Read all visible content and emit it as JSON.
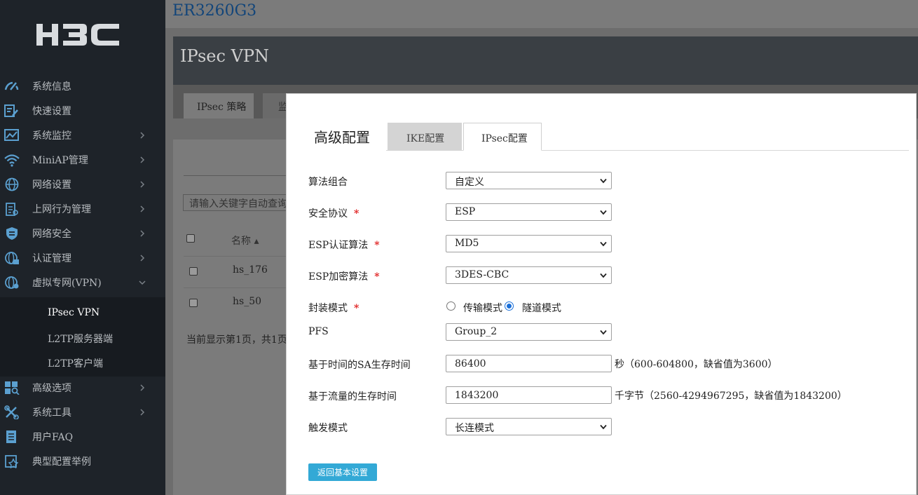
{
  "brand": {
    "logo_text": "H3C",
    "model": "ER3260G3"
  },
  "sidebar": {
    "items": [
      {
        "label": "系统信息",
        "icon": "speedometer-icon",
        "has_arrow": false
      },
      {
        "label": "快速设置",
        "icon": "edit-doc-icon",
        "has_arrow": false
      },
      {
        "label": "系统监控",
        "icon": "monitor-chart-icon",
        "has_arrow": true
      },
      {
        "label": "MiniAP管理",
        "icon": "wifi-icon",
        "has_arrow": true
      },
      {
        "label": "网络设置",
        "icon": "globe-icon",
        "has_arrow": true
      },
      {
        "label": "上网行为管理",
        "icon": "clipboard-icon",
        "has_arrow": true
      },
      {
        "label": "网络安全",
        "icon": "shield-icon",
        "has_arrow": true
      },
      {
        "label": "认证管理",
        "icon": "globe-lock-icon",
        "has_arrow": true
      },
      {
        "label": "虚拟专网(VPN)",
        "icon": "globe-vpn-icon",
        "has_arrow": true,
        "expanded": true
      },
      {
        "label": "高级选项",
        "icon": "grid-search-icon",
        "has_arrow": true
      },
      {
        "label": "系统工具",
        "icon": "tools-icon",
        "has_arrow": true
      },
      {
        "label": "用户FAQ",
        "icon": "document-icon",
        "has_arrow": false
      },
      {
        "label": "典型配置举例",
        "icon": "config-example-icon",
        "has_arrow": false
      }
    ],
    "vpn_subitems": [
      {
        "label": "IPsec VPN",
        "active": true
      },
      {
        "label": "L2TP服务器端",
        "active": false
      },
      {
        "label": "L2TP客户端",
        "active": false
      }
    ]
  },
  "page": {
    "title": "IPsec VPN",
    "tabs": [
      "IPsec 策略",
      "监"
    ],
    "search_placeholder": "请输入关键字自动查询",
    "table": {
      "header_name": "名称",
      "rows": [
        "hs_176",
        "hs_50"
      ]
    },
    "pagination_text": "当前显示第1页，共1页,"
  },
  "modal": {
    "title": "高级配置",
    "tabs": [
      {
        "label": "IKE配置",
        "active": false
      },
      {
        "label": "IPsec配置",
        "active": true
      }
    ],
    "fields": {
      "algorithm_suite": {
        "label": "算法组合",
        "value": "自定义"
      },
      "security_protocol": {
        "label": "安全协议",
        "value": "ESP",
        "required": "*"
      },
      "esp_auth": {
        "label": "ESP认证算法",
        "value": "MD5",
        "required": "*"
      },
      "esp_encrypt": {
        "label": "ESP加密算法",
        "value": "3DES-CBC",
        "required": "*"
      },
      "encap_mode": {
        "label": "封装模式",
        "required": "*",
        "options": [
          "传输模式",
          "隧道模式"
        ],
        "selected": "隧道模式"
      },
      "pfs": {
        "label": "PFS",
        "value": "Group_2"
      },
      "sa_time": {
        "label": "基于时间的SA生存时间",
        "value": "86400",
        "hint": "秒（600-604800，缺省值为3600）"
      },
      "sa_traffic": {
        "label": "基于流量的生存时间",
        "value": "1843200",
        "hint": "千字节（2560-4294967295，缺省值为1843200）"
      },
      "trigger_mode": {
        "label": "触发模式",
        "value": "长连模式"
      }
    },
    "back_button": "返回基本设置"
  },
  "colors": {
    "sidebar_bg": "#1e2329",
    "accent_button": "#33a9d6",
    "required_star": "#e02020",
    "radio_selected": "#1a6fd8"
  }
}
